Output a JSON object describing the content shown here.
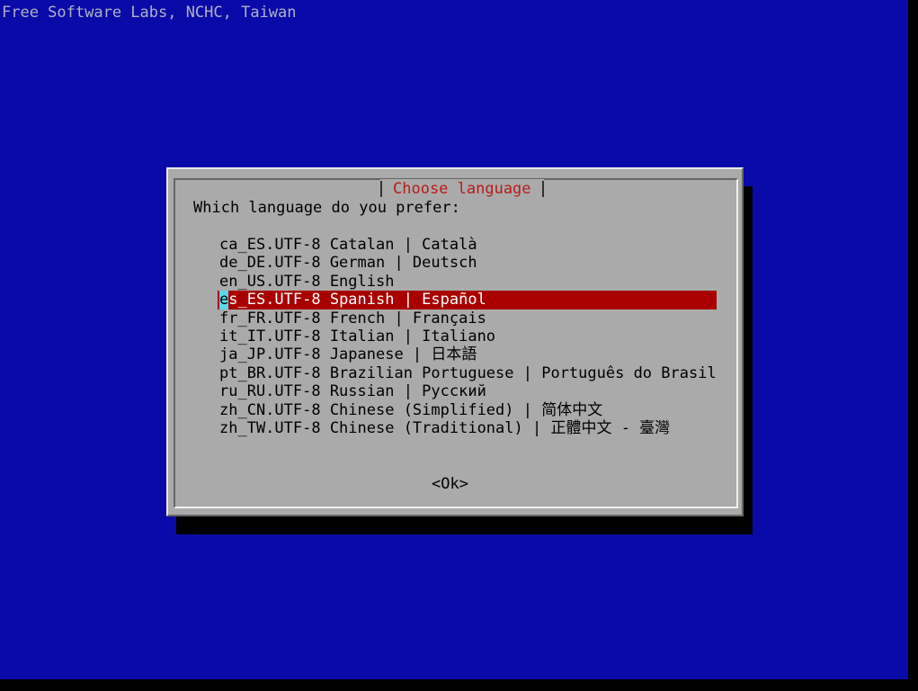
{
  "backtitle": "Free Software Labs, NCHC, Taiwan",
  "dialog": {
    "title": "Choose language",
    "prompt": "Which language do you prefer:",
    "items": [
      {
        "label": "ca_ES.UTF-8 Catalan | Català"
      },
      {
        "label": "de_DE.UTF-8 German | Deutsch"
      },
      {
        "label": "en_US.UTF-8 English"
      },
      {
        "cursor_char": "e",
        "label_rest": "s_ES.UTF-8 Spanish | Español",
        "selected": true
      },
      {
        "label": "fr_FR.UTF-8 French | Français"
      },
      {
        "label": "it_IT.UTF-8 Italian | Italiano"
      },
      {
        "label": "ja_JP.UTF-8 Japanese | 日本語"
      },
      {
        "label": "pt_BR.UTF-8 Brazilian Portuguese | Português do Brasil"
      },
      {
        "label": "ru_RU.UTF-8 Russian | Русский"
      },
      {
        "label": "zh_CN.UTF-8 Chinese (Simplified) | 简体中文"
      },
      {
        "label": "zh_TW.UTF-8 Chinese (Traditional) | 正體中文 - 臺灣"
      }
    ],
    "ok_label": "<Ok>"
  },
  "colors": {
    "background": "#0a0aa8",
    "dialog": "#aaaaaa",
    "title": "#b81c1c",
    "selection": "#a80000",
    "cursor": "#5ad8e8"
  }
}
